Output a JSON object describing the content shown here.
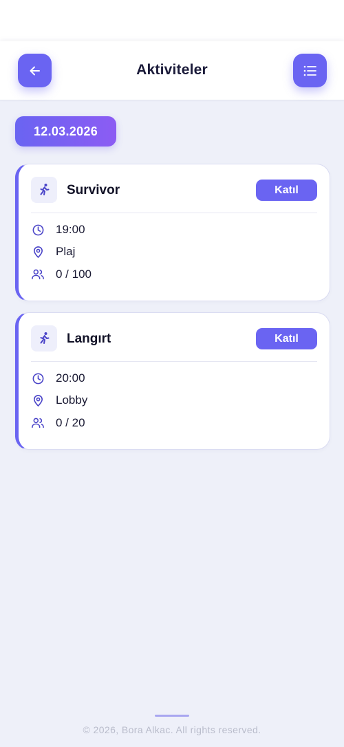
{
  "header": {
    "title": "Aktiviteler",
    "back_icon": "arrow-left-icon",
    "menu_icon": "list-icon",
    "accent": "#6a64f2"
  },
  "date": "12.03.2026",
  "activities": [
    {
      "title": "Survivor",
      "icon": "running-person-icon",
      "join_label": "Katıl",
      "time": "19:00",
      "location": "Plaj",
      "capacity": "0 / 100"
    },
    {
      "title": "Langırt",
      "icon": "running-person-icon",
      "join_label": "Katıl",
      "time": "20:00",
      "location": "Lobby",
      "capacity": "0 / 20"
    }
  ],
  "footer": {
    "copyright": "© 2026, Bora Alkac. All rights reserved."
  }
}
